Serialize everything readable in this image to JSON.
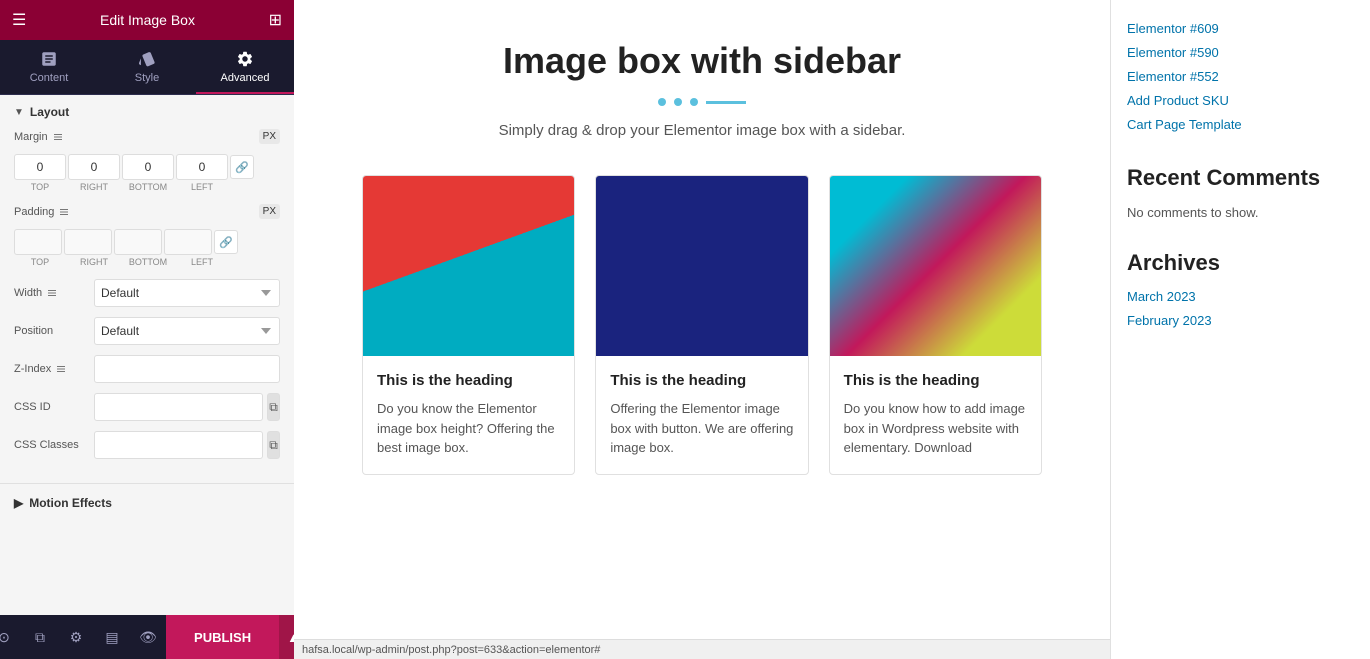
{
  "panel": {
    "header": {
      "title": "Edit Image Box",
      "hamburger": "☰",
      "grid": "⊞"
    },
    "tabs": [
      {
        "id": "content",
        "label": "Content",
        "active": false
      },
      {
        "id": "style",
        "label": "Style",
        "active": false
      },
      {
        "id": "advanced",
        "label": "Advanced",
        "active": true
      }
    ],
    "layout": {
      "section_label": "Layout",
      "margin_label": "Margin",
      "margin_unit": "PX",
      "margin_top": "0",
      "margin_right": "0",
      "margin_bottom": "0",
      "margin_left": "0",
      "margin_top_label": "TOP",
      "margin_right_label": "RIGHT",
      "margin_bottom_label": "BOTTOM",
      "margin_left_label": "LEFT",
      "padding_label": "Padding",
      "padding_unit": "PX",
      "padding_top": "",
      "padding_right": "",
      "padding_bottom": "",
      "padding_left": "",
      "padding_top_label": "TOP",
      "padding_right_label": "RIGHT",
      "padding_bottom_label": "BOTTOM",
      "padding_left_label": "LEFT",
      "width_label": "Width",
      "width_option": "Default",
      "position_label": "Position",
      "position_option": "Default",
      "zindex_label": "Z-Index",
      "cssid_label": "CSS ID",
      "cssclass_label": "CSS Classes"
    },
    "motion_effects": {
      "label": "Motion Effects"
    },
    "publish_btn": "PUBLISH"
  },
  "main": {
    "title": "Image box with sidebar",
    "subtitle": "Simply drag & drop your Elementor image box with a sidebar.",
    "cards": [
      {
        "heading": "This is the heading",
        "text": "Do you know the Elementor image box height? Offering the best image box."
      },
      {
        "heading": "This is the heading",
        "text": "Offering the Elementor image box with button. We are offering image box."
      },
      {
        "heading": "This is the heading",
        "text": "Do you know how to add image box in Wordpress website with elementary. Download"
      }
    ]
  },
  "sidebar": {
    "links": [
      "Elementor #609",
      "Elementor #590",
      "Elementor #552",
      "Add Product SKU",
      "Cart Page Template"
    ],
    "recent_comments_title": "Recent Comments",
    "no_comments": "No comments to show.",
    "archives_title": "Archives",
    "archive_links": [
      "March 2023",
      "February 2023"
    ]
  },
  "url_bar": {
    "text": "hafsa.local/wp-admin/post.php?post=633&action=elementor#"
  }
}
